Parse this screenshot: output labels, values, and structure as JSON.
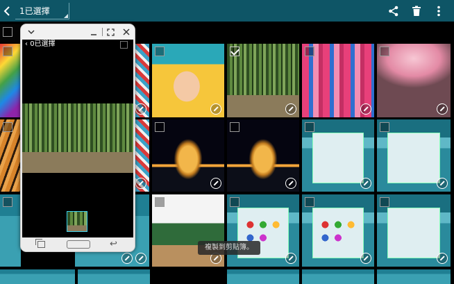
{
  "topbar": {
    "selection_label": "1已選擇",
    "back_icon": "chevron-left-icon",
    "actions": [
      {
        "name": "share",
        "icon": "share-icon"
      },
      {
        "name": "delete",
        "icon": "trash-icon"
      },
      {
        "name": "more",
        "icon": "more-vert-icon"
      }
    ],
    "bar_color": "#0e5566"
  },
  "popup": {
    "selection_label": "0已選擇",
    "titlebar_icons": [
      "chevron-down-icon",
      "minimize-icon",
      "fullscreen-icon",
      "close-icon"
    ],
    "nav_icons": [
      "recent-apps-icon",
      "home-button",
      "back-arrow-icon"
    ],
    "border_color": "#c8c8c8"
  },
  "toast": {
    "text": "複製到剪貼簿。"
  },
  "grid": {
    "checked_tile": "forest",
    "accent": "#3ad1ee"
  }
}
